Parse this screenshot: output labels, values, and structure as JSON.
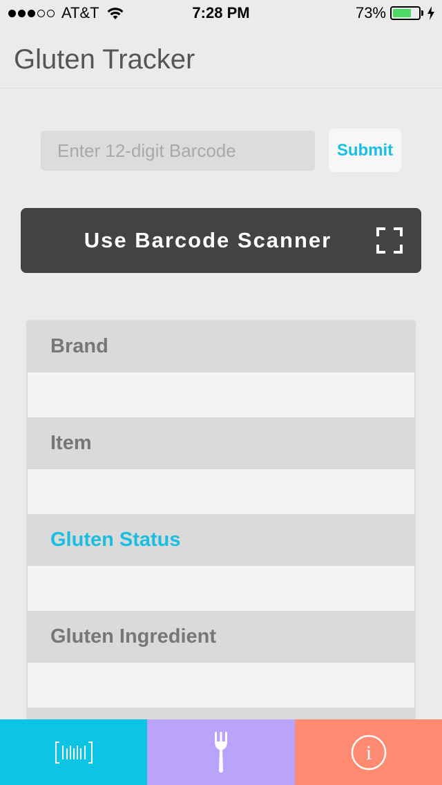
{
  "status_bar": {
    "carrier": "AT&T",
    "time": "7:28 PM",
    "battery_percent": "73%",
    "battery_level": 0.73,
    "signal_bars_filled": 3,
    "signal_bars_total": 5
  },
  "header": {
    "title": "Gluten Tracker"
  },
  "search": {
    "placeholder": "Enter 12-digit Barcode",
    "value": "",
    "submit_label": "Submit"
  },
  "scanner": {
    "label": "Use Barcode Scanner",
    "icon": "scan-frame-icon"
  },
  "fields": [
    {
      "label": "Brand",
      "value": ""
    },
    {
      "label": "Item",
      "value": ""
    },
    {
      "label": "Gluten Status",
      "value": ""
    },
    {
      "label": "Gluten Ingredient",
      "value": ""
    }
  ],
  "tabs": [
    {
      "name": "scan",
      "icon": "barcode-icon",
      "color": "#0cc4e4"
    },
    {
      "name": "food",
      "icon": "fork-icon",
      "color": "#baa3fb"
    },
    {
      "name": "info",
      "icon": "info-icon",
      "color": "#ff8a72"
    }
  ],
  "colors": {
    "accent": "#18bfe0",
    "scanner_bg": "#434343",
    "battery_fill": "#4cd964"
  }
}
